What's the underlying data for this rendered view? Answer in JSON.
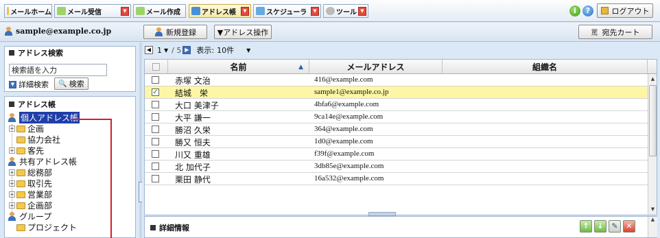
{
  "nav": {
    "tabs": [
      {
        "label": "メールホーム",
        "icon": "home-icon"
      },
      {
        "label": "メール受信",
        "icon": "mail-receive-icon"
      },
      {
        "label": "メール作成",
        "icon": "mail-compose-icon"
      },
      {
        "label": "アドレス帳",
        "icon": "address-book-icon"
      },
      {
        "label": "スケジューラ",
        "icon": "calendar-icon"
      },
      {
        "label": "ツール",
        "icon": "tools-icon"
      }
    ],
    "logout_label": "ログアウト"
  },
  "toolbar": {
    "user_email": "sample@example.co.jp",
    "new_label": "新規登録",
    "address_ops_label": "▼アドレス操作",
    "dest_cart_label": "宛先カート"
  },
  "search": {
    "title": "アドレス検索",
    "placeholder": "検索語を入力",
    "detail_label": "詳細検索",
    "search_button": "検索"
  },
  "address_book": {
    "title": "アドレス帳",
    "tree": [
      "個人アドレス帳",
      "企画",
      "協力会社",
      "客先",
      "共有アドレス帳",
      "総務部",
      "取引先",
      "営業部",
      "企画部",
      "グループ",
      "プロジェクト"
    ]
  },
  "pager": {
    "current": "1",
    "total": "/ 5",
    "display_label": "表示:",
    "per_page": "10件"
  },
  "table": {
    "columns": [
      "名前",
      "メールアドレス",
      "組織名"
    ],
    "rows": [
      {
        "name": "赤塚 文治",
        "email": "416@example.com",
        "checked": false,
        "selected": false
      },
      {
        "name": "結城　栄",
        "email": "sample1@example.co.jp",
        "checked": true,
        "selected": true
      },
      {
        "name": "大口 美津子",
        "email": "4bfa6@example.com",
        "checked": false,
        "selected": false
      },
      {
        "name": "大平 謙一",
        "email": "9ca14e@example.com",
        "checked": false,
        "selected": false
      },
      {
        "name": "勝沼 久栄",
        "email": "364@example.com",
        "checked": false,
        "selected": false
      },
      {
        "name": "勝又 恒夫",
        "email": "1d0@example.com",
        "checked": false,
        "selected": false
      },
      {
        "name": "川又 重雄",
        "email": "f39f@example.com",
        "checked": false,
        "selected": false
      },
      {
        "name": "北 加代子",
        "email": "3db85e@example.com",
        "checked": false,
        "selected": false
      },
      {
        "name": "栗田 静代",
        "email": "16a532@example.com",
        "checked": false,
        "selected": false
      }
    ]
  },
  "detail": {
    "title": "詳細情報"
  },
  "colors": {
    "selected_row": "#fdf6a4",
    "tree_selected": "#1f3fa8",
    "annotation_line": "#d0202a",
    "dropdown_red": "#e24a3b"
  }
}
